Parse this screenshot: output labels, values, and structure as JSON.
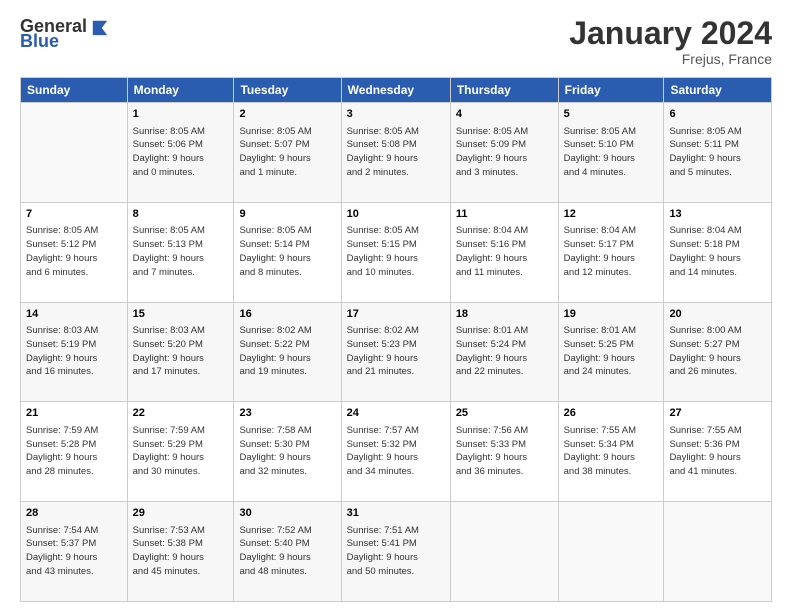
{
  "header": {
    "logo_general": "General",
    "logo_blue": "Blue",
    "month_title": "January 2024",
    "location": "Frejus, France"
  },
  "days_of_week": [
    "Sunday",
    "Monday",
    "Tuesday",
    "Wednesday",
    "Thursday",
    "Friday",
    "Saturday"
  ],
  "weeks": [
    [
      {
        "day": "",
        "info": ""
      },
      {
        "day": "1",
        "info": "Sunrise: 8:05 AM\nSunset: 5:06 PM\nDaylight: 9 hours\nand 0 minutes."
      },
      {
        "day": "2",
        "info": "Sunrise: 8:05 AM\nSunset: 5:07 PM\nDaylight: 9 hours\nand 1 minute."
      },
      {
        "day": "3",
        "info": "Sunrise: 8:05 AM\nSunset: 5:08 PM\nDaylight: 9 hours\nand 2 minutes."
      },
      {
        "day": "4",
        "info": "Sunrise: 8:05 AM\nSunset: 5:09 PM\nDaylight: 9 hours\nand 3 minutes."
      },
      {
        "day": "5",
        "info": "Sunrise: 8:05 AM\nSunset: 5:10 PM\nDaylight: 9 hours\nand 4 minutes."
      },
      {
        "day": "6",
        "info": "Sunrise: 8:05 AM\nSunset: 5:11 PM\nDaylight: 9 hours\nand 5 minutes."
      }
    ],
    [
      {
        "day": "7",
        "info": "Sunrise: 8:05 AM\nSunset: 5:12 PM\nDaylight: 9 hours\nand 6 minutes."
      },
      {
        "day": "8",
        "info": "Sunrise: 8:05 AM\nSunset: 5:13 PM\nDaylight: 9 hours\nand 7 minutes."
      },
      {
        "day": "9",
        "info": "Sunrise: 8:05 AM\nSunset: 5:14 PM\nDaylight: 9 hours\nand 8 minutes."
      },
      {
        "day": "10",
        "info": "Sunrise: 8:05 AM\nSunset: 5:15 PM\nDaylight: 9 hours\nand 10 minutes."
      },
      {
        "day": "11",
        "info": "Sunrise: 8:04 AM\nSunset: 5:16 PM\nDaylight: 9 hours\nand 11 minutes."
      },
      {
        "day": "12",
        "info": "Sunrise: 8:04 AM\nSunset: 5:17 PM\nDaylight: 9 hours\nand 12 minutes."
      },
      {
        "day": "13",
        "info": "Sunrise: 8:04 AM\nSunset: 5:18 PM\nDaylight: 9 hours\nand 14 minutes."
      }
    ],
    [
      {
        "day": "14",
        "info": "Sunrise: 8:03 AM\nSunset: 5:19 PM\nDaylight: 9 hours\nand 16 minutes."
      },
      {
        "day": "15",
        "info": "Sunrise: 8:03 AM\nSunset: 5:20 PM\nDaylight: 9 hours\nand 17 minutes."
      },
      {
        "day": "16",
        "info": "Sunrise: 8:02 AM\nSunset: 5:22 PM\nDaylight: 9 hours\nand 19 minutes."
      },
      {
        "day": "17",
        "info": "Sunrise: 8:02 AM\nSunset: 5:23 PM\nDaylight: 9 hours\nand 21 minutes."
      },
      {
        "day": "18",
        "info": "Sunrise: 8:01 AM\nSunset: 5:24 PM\nDaylight: 9 hours\nand 22 minutes."
      },
      {
        "day": "19",
        "info": "Sunrise: 8:01 AM\nSunset: 5:25 PM\nDaylight: 9 hours\nand 24 minutes."
      },
      {
        "day": "20",
        "info": "Sunrise: 8:00 AM\nSunset: 5:27 PM\nDaylight: 9 hours\nand 26 minutes."
      }
    ],
    [
      {
        "day": "21",
        "info": "Sunrise: 7:59 AM\nSunset: 5:28 PM\nDaylight: 9 hours\nand 28 minutes."
      },
      {
        "day": "22",
        "info": "Sunrise: 7:59 AM\nSunset: 5:29 PM\nDaylight: 9 hours\nand 30 minutes."
      },
      {
        "day": "23",
        "info": "Sunrise: 7:58 AM\nSunset: 5:30 PM\nDaylight: 9 hours\nand 32 minutes."
      },
      {
        "day": "24",
        "info": "Sunrise: 7:57 AM\nSunset: 5:32 PM\nDaylight: 9 hours\nand 34 minutes."
      },
      {
        "day": "25",
        "info": "Sunrise: 7:56 AM\nSunset: 5:33 PM\nDaylight: 9 hours\nand 36 minutes."
      },
      {
        "day": "26",
        "info": "Sunrise: 7:55 AM\nSunset: 5:34 PM\nDaylight: 9 hours\nand 38 minutes."
      },
      {
        "day": "27",
        "info": "Sunrise: 7:55 AM\nSunset: 5:36 PM\nDaylight: 9 hours\nand 41 minutes."
      }
    ],
    [
      {
        "day": "28",
        "info": "Sunrise: 7:54 AM\nSunset: 5:37 PM\nDaylight: 9 hours\nand 43 minutes."
      },
      {
        "day": "29",
        "info": "Sunrise: 7:53 AM\nSunset: 5:38 PM\nDaylight: 9 hours\nand 45 minutes."
      },
      {
        "day": "30",
        "info": "Sunrise: 7:52 AM\nSunset: 5:40 PM\nDaylight: 9 hours\nand 48 minutes."
      },
      {
        "day": "31",
        "info": "Sunrise: 7:51 AM\nSunset: 5:41 PM\nDaylight: 9 hours\nand 50 minutes."
      },
      {
        "day": "",
        "info": ""
      },
      {
        "day": "",
        "info": ""
      },
      {
        "day": "",
        "info": ""
      }
    ]
  ]
}
